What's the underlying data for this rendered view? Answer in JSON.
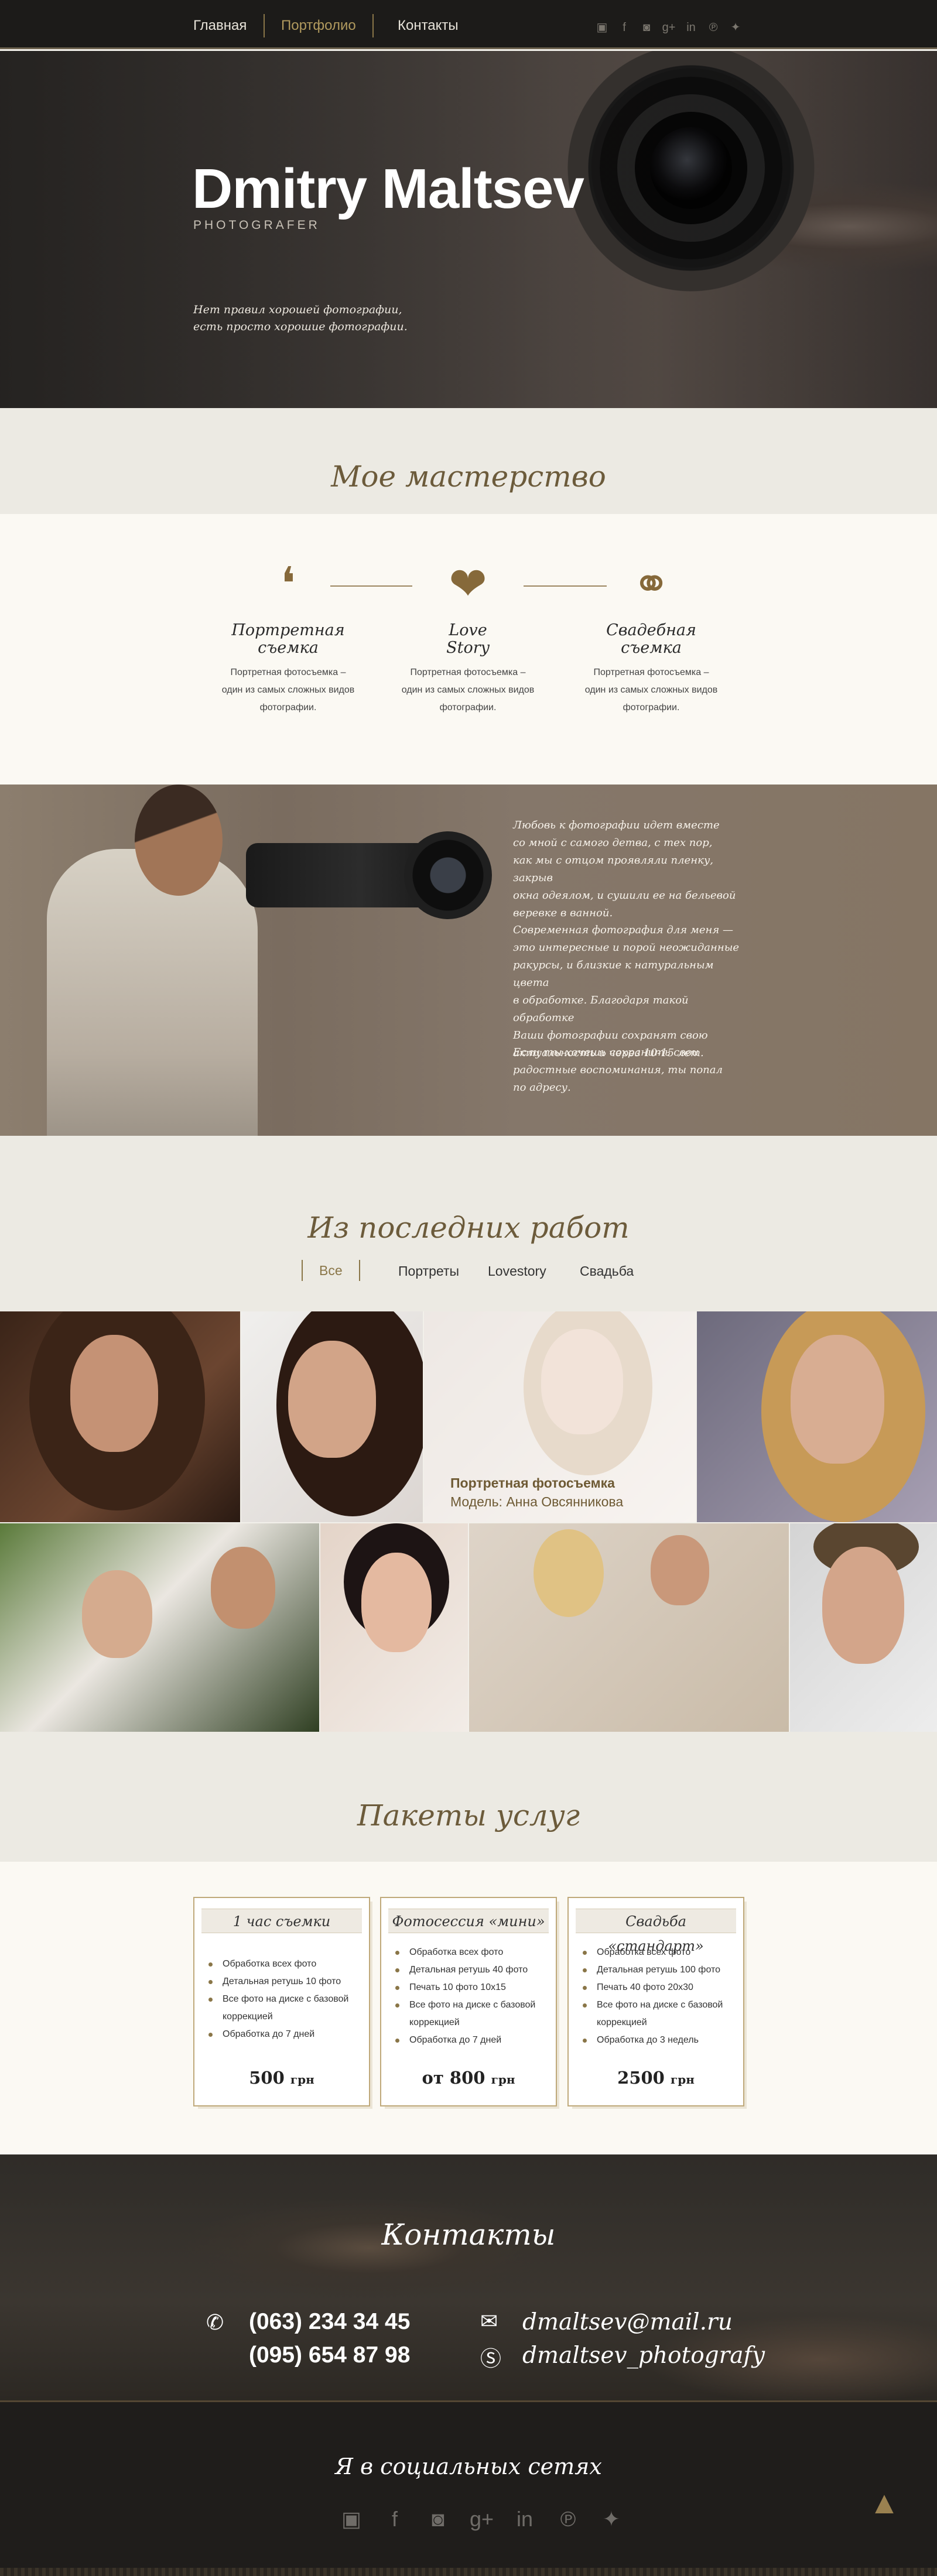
{
  "nav": {
    "items": [
      {
        "label": "Главная"
      },
      {
        "label": "Портфолио"
      },
      {
        "label": "Контакты"
      }
    ],
    "active": "Портфолио",
    "social_icons": [
      "vk-icon",
      "facebook-icon",
      "instagram-icon",
      "googleplus-icon",
      "linkedin-icon",
      "pinterest-icon",
      "twitter-icon"
    ]
  },
  "hero": {
    "title": "Dmitry Maltsev",
    "subtitle": "PHOTOGRAFER",
    "quote_line1": "Нет правил хорошей фотографии,",
    "quote_line2": "есть просто хорошие фотографии."
  },
  "skills": {
    "section_title": "Мое мастерство",
    "items": [
      {
        "icon": "speech-bubble-icon",
        "title": "Портретная\nсъемка",
        "text": "Портретная фотосъемка –\nодин из самых сложных видов\nфотографии."
      },
      {
        "icon": "hearts-icon",
        "title": "Love\nStory",
        "text": "Портретная фотосъемка –\nодин из самых сложных видов\nфотографии."
      },
      {
        "icon": "rings-icon",
        "title": "Свадебная\nсъемка",
        "text": "Портретная фотосъемка –\nодин из самых сложных видов\nфотографии."
      }
    ]
  },
  "about": {
    "paragraph1": "Любовь к фотографии идет вместе\nсо мной с самого детва,  с тех пор,\nкак мы с отцом проявляли пленку, закрыв\nокна одеялом, и сушили ее на бельевой\nверевке в ванной.",
    "paragraph2": "Современная фотография для меня —\nэто интересные и порой неожиданные\nракурсы, и близкие к натуральным цвета\nв обработке. Благодаря такой обработке\nВаши фотографии сохранят свою\nактуальность и через 10-15 лет.",
    "paragraph3": "Если ты хочешь сохранить свои\nрадостные воспоминания,  ты попал\nпо адресу."
  },
  "works": {
    "section_title": "Из последних работ",
    "filters": [
      "Все",
      "Портреты",
      "Lovestory",
      "Свадьба"
    ],
    "active_filter": "Все",
    "overlay_category": "Портретная фотосъемка",
    "overlay_model": "Модель: Анна Овсянникова"
  },
  "packages": {
    "section_title": "Пакеты услуг",
    "items": [
      {
        "title": "1 час съемки",
        "features": [
          "Обработка всех фото",
          "Детальная ретушь 10 фото",
          "Все фото на диске с базовой коррекцией",
          "Обработка до 7 дней"
        ],
        "price": "500",
        "currency": "грн"
      },
      {
        "title": "Фотосессия «мини»",
        "features": [
          "Обработка всех фото",
          "Детальная ретушь 40 фото",
          "Печать 10 фото 10х15",
          "Все фото на диске с базовой коррекцией",
          "Обработка до 7 дней"
        ],
        "price": "от 800",
        "currency": "грн"
      },
      {
        "title": "Свадьба «стандарт»",
        "features": [
          "Обработка всех фото",
          "Детальная ретушь 100 фото",
          "Печать 40 фото 20х30",
          "Все фото на диске с базовой коррекцией",
          "Обработка до 3 недель"
        ],
        "price": "2500",
        "currency": "грн"
      }
    ]
  },
  "contacts": {
    "title": "Контакты",
    "phone1": "(063) 234 34 45",
    "phone2": "(095) 654 87 98",
    "email": "dmaltsev@mail.ru",
    "skype": "dmaltsev_photografy"
  },
  "footer": {
    "social_title": "Я в социальных сетях",
    "social_icons": [
      "vk-icon",
      "facebook-icon",
      "instagram-icon",
      "googleplus-icon",
      "linkedin-icon",
      "pinterest-icon",
      "twitter-icon"
    ]
  },
  "colors": {
    "accent": "#8a7648",
    "dark": "#1c1b19",
    "cream": "#fbf9f3"
  }
}
